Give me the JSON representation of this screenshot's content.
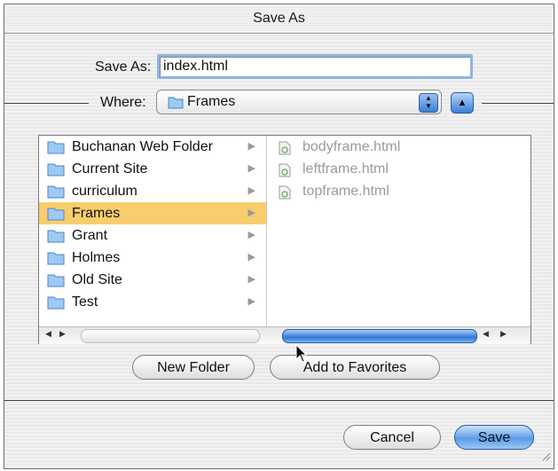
{
  "window": {
    "title": "Save As"
  },
  "save_as": {
    "label": "Save As:",
    "value": "index.html"
  },
  "where": {
    "label": "Where:",
    "selected": "Frames"
  },
  "folders": [
    {
      "label": "Buchanan Web Folder",
      "selected": false
    },
    {
      "label": "Current Site",
      "selected": false
    },
    {
      "label": "curriculum",
      "selected": false
    },
    {
      "label": "Frames",
      "selected": true
    },
    {
      "label": "Grant",
      "selected": false
    },
    {
      "label": "Holmes",
      "selected": false
    },
    {
      "label": "Old Site",
      "selected": false
    },
    {
      "label": "Test",
      "selected": false
    }
  ],
  "files": [
    {
      "label": "bodyframe.html"
    },
    {
      "label": "leftframe.html"
    },
    {
      "label": "topframe.html"
    }
  ],
  "buttons": {
    "new_folder": "New Folder",
    "add_to_favorites": "Add to Favorites",
    "cancel": "Cancel",
    "save": "Save"
  },
  "colors": {
    "selection": "#f8cd6d",
    "accent_blue": "#3a7fd9"
  },
  "icons": {
    "folder": "folder-icon",
    "file": "html-file-icon",
    "disclosure": "disclosure-triangle-icon"
  }
}
